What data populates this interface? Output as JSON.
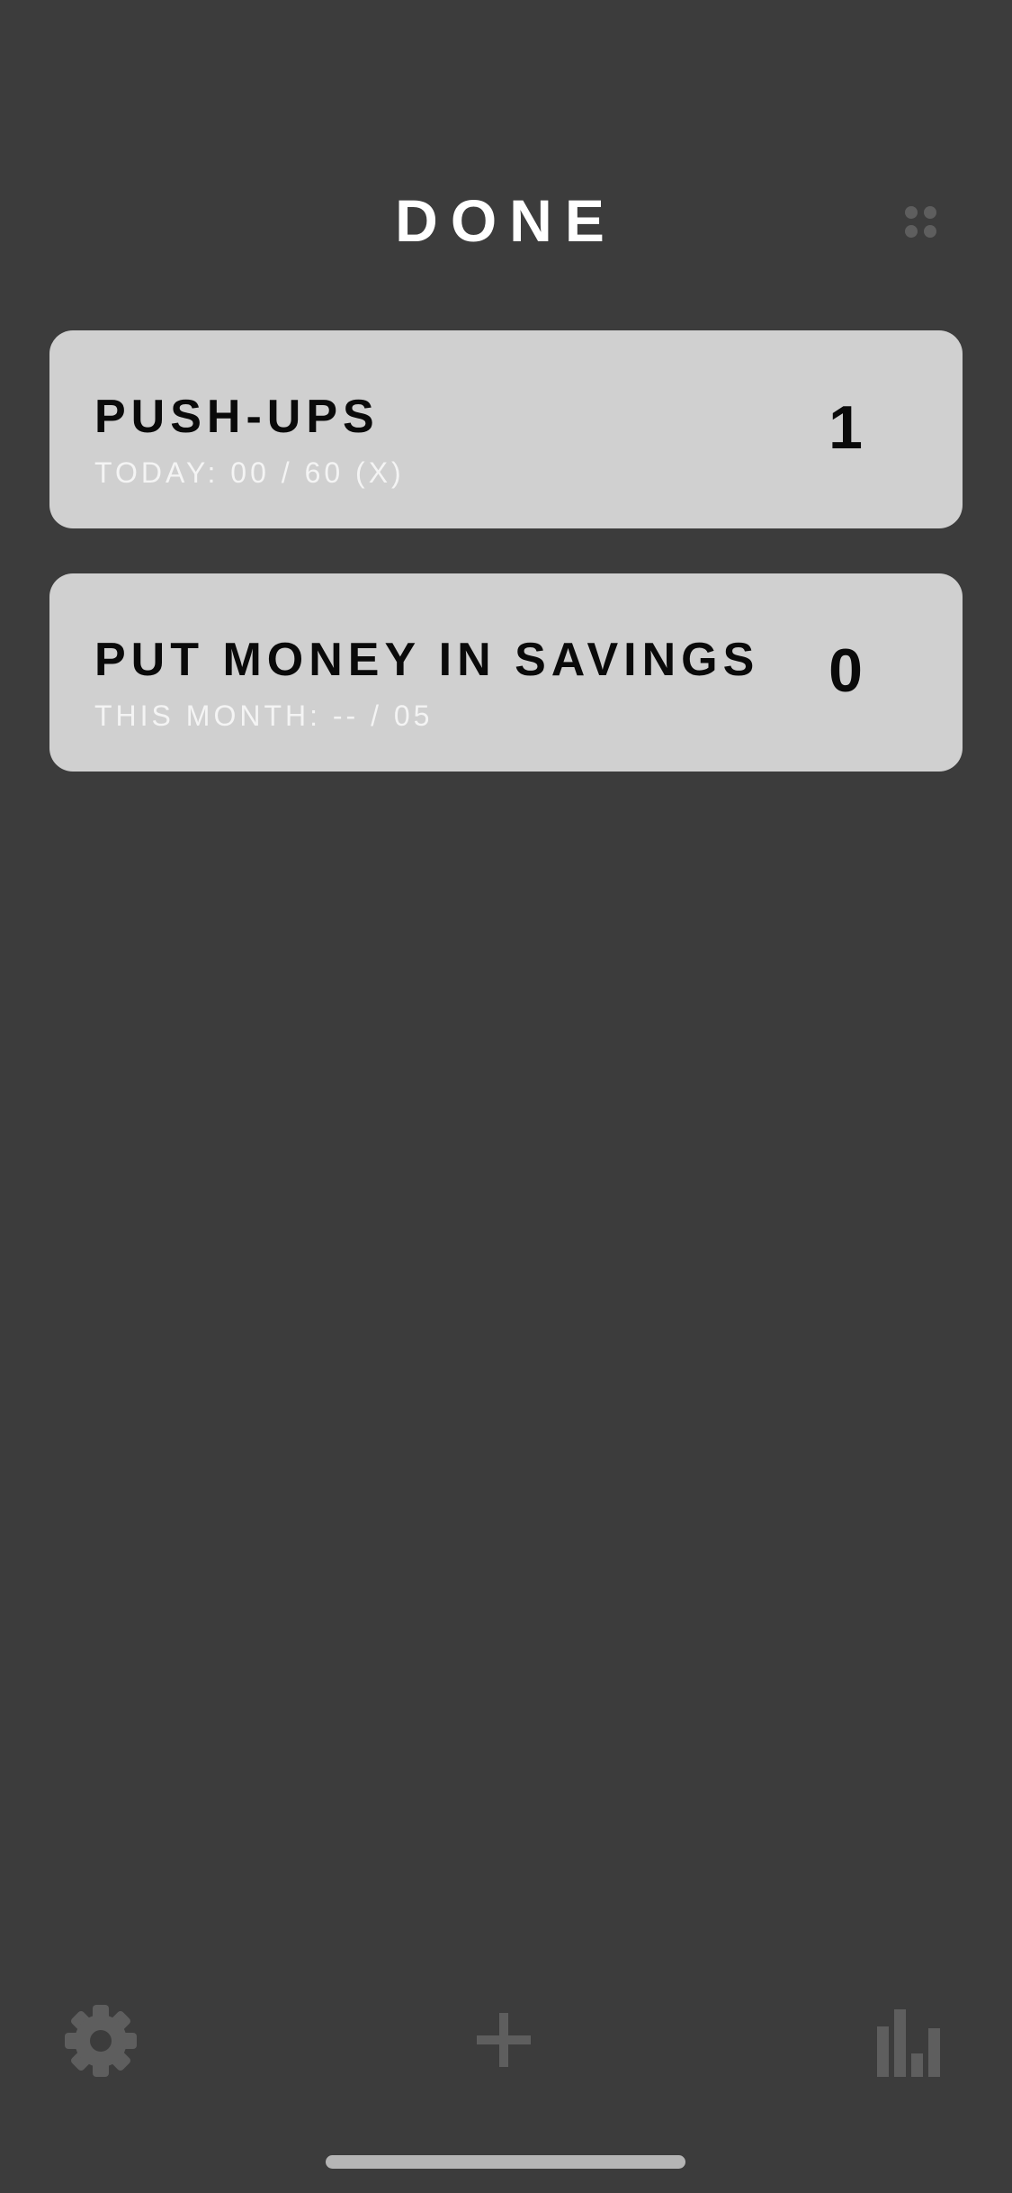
{
  "header": {
    "title": "DONE",
    "grid_icon": "grid-icon"
  },
  "habits": [
    {
      "name": "PUSH-UPS",
      "progress": "TODAY: 00 / 60 (X)",
      "count": "1"
    },
    {
      "name": "PUT MONEY IN SAVINGS",
      "progress": "THIS MONTH: -- / 05",
      "count": "0"
    }
  ],
  "tabbar": {
    "settings_icon": "gear-icon",
    "add_icon": "plus-icon",
    "stats_icon": "bar-chart-icon"
  },
  "colors": {
    "background": "#3c3c3c",
    "card": "#d0d0d0",
    "icon_muted": "#5e5e5e",
    "title_text": "#ffffff"
  }
}
